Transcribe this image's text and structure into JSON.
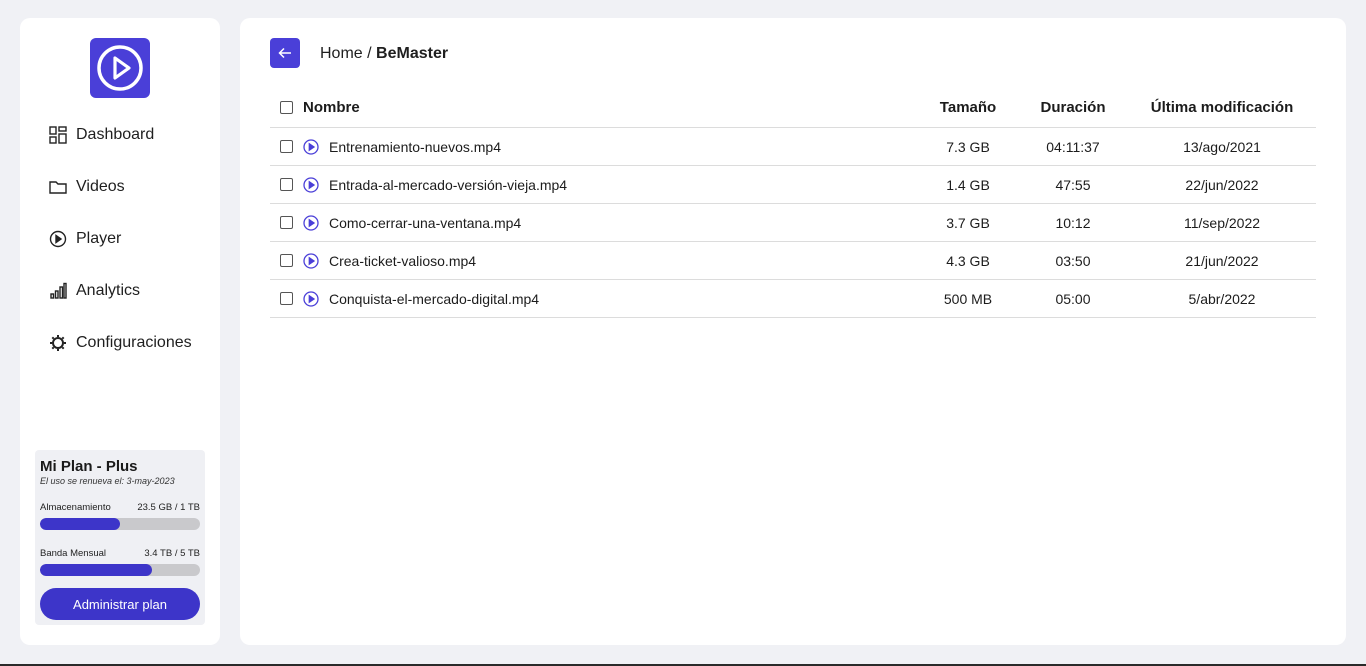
{
  "sidebar": {
    "items": [
      {
        "label": "Dashboard",
        "icon": "dashboard-grid-icon"
      },
      {
        "label": "Videos",
        "icon": "folder-icon"
      },
      {
        "label": "Player",
        "icon": "play-circle-icon"
      },
      {
        "label": "Analytics",
        "icon": "bar-chart-icon"
      },
      {
        "label": "Configuraciones",
        "icon": "gear-icon"
      }
    ]
  },
  "plan": {
    "title": "Mi Plan - Plus",
    "renewal": "El uso se renueva el: 3-may-2023",
    "storage_label": "Almacenamiento",
    "storage_value": "23.5 GB / 1 TB",
    "storage_fraction": 0.5,
    "bandwidth_label": "Banda Mensual",
    "bandwidth_value": "3.4 TB / 5 TB",
    "bandwidth_fraction": 0.7,
    "button_label": "Administrar plan"
  },
  "breadcrumb": {
    "root": "Home",
    "separator": " / ",
    "current": "BeMaster"
  },
  "table": {
    "headers": {
      "name": "Nombre",
      "size": "Tamaño",
      "duration": "Duración",
      "modified": "Última modificación"
    },
    "rows": [
      {
        "name": "Entrenamiento-nuevos.mp4",
        "size": "7.3 GB",
        "duration": "04:11:37",
        "modified": "13/ago/2021"
      },
      {
        "name": "Entrada-al-mercado-versión-vieja.mp4",
        "size": "1.4 GB",
        "duration": "47:55",
        "modified": "22/jun/2022"
      },
      {
        "name": "Como-cerrar-una-ventana.mp4",
        "size": "3.7 GB",
        "duration": "10:12",
        "modified": "11/sep/2022"
      },
      {
        "name": "Crea-ticket-valioso.mp4",
        "size": "4.3 GB",
        "duration": "03:50",
        "modified": "21/jun/2022"
      },
      {
        "name": "Conquista-el-mercado-digital.mp4",
        "size": "500 MB",
        "duration": "05:00",
        "modified": "5/abr/2022"
      }
    ]
  },
  "colors": {
    "accent": "#4a3fd8",
    "accent_dark": "#3d35c9",
    "background": "#f0f1f5",
    "bar_track": "#c9c9cc"
  }
}
